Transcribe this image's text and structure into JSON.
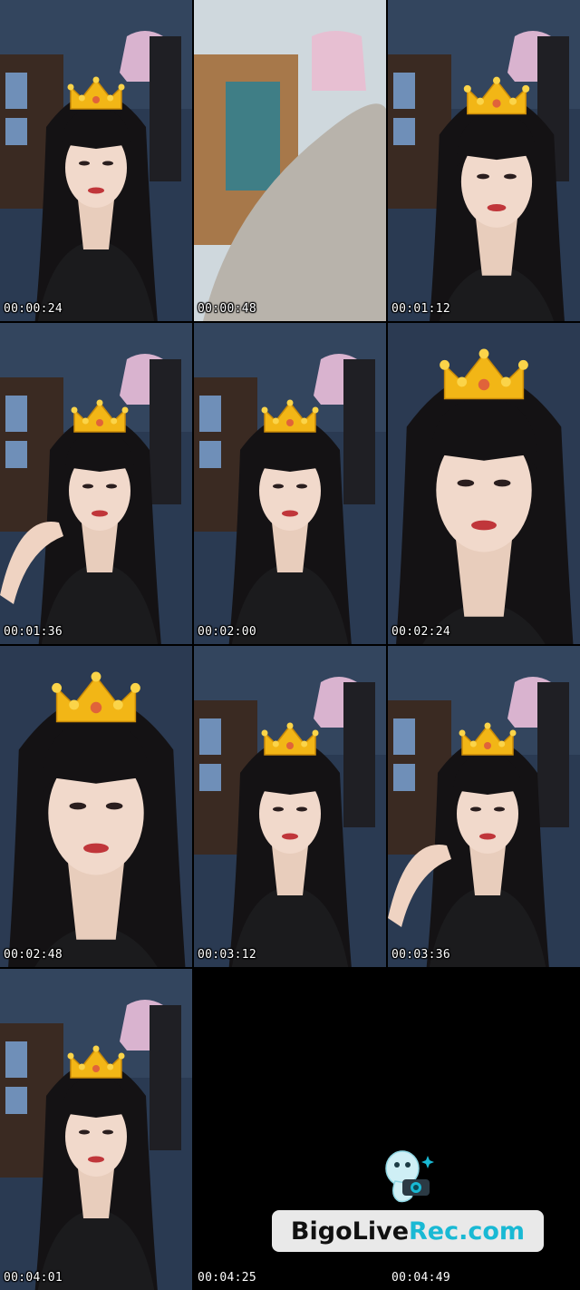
{
  "thumbnails": [
    {
      "timestamp": "00:00:24",
      "scene": "face-crown"
    },
    {
      "timestamp": "00:00:48",
      "scene": "room-hair"
    },
    {
      "timestamp": "00:01:12",
      "scene": "face-turned"
    },
    {
      "timestamp": "00:01:36",
      "scene": "face-hand"
    },
    {
      "timestamp": "00:02:00",
      "scene": "face-crown"
    },
    {
      "timestamp": "00:02:24",
      "scene": "face-close"
    },
    {
      "timestamp": "00:02:48",
      "scene": "face-close"
    },
    {
      "timestamp": "00:03:12",
      "scene": "face-crown"
    },
    {
      "timestamp": "00:03:36",
      "scene": "face-hand"
    },
    {
      "timestamp": "00:04:01",
      "scene": "face-crown"
    },
    {
      "timestamp": "00:04:25",
      "scene": "black"
    },
    {
      "timestamp": "00:04:49",
      "scene": "black"
    }
  ],
  "watermark": {
    "text_part1": "BigoLive",
    "text_part2": "Rec.com",
    "icon": "bigo-mascot-camera-icon"
  },
  "colors": {
    "background": "#000000",
    "timestamp_text": "#ffffff",
    "watermark_banner": "#e9e9e9",
    "watermark_accent": "#19b9d4",
    "crown_gold": "#f2b616"
  }
}
